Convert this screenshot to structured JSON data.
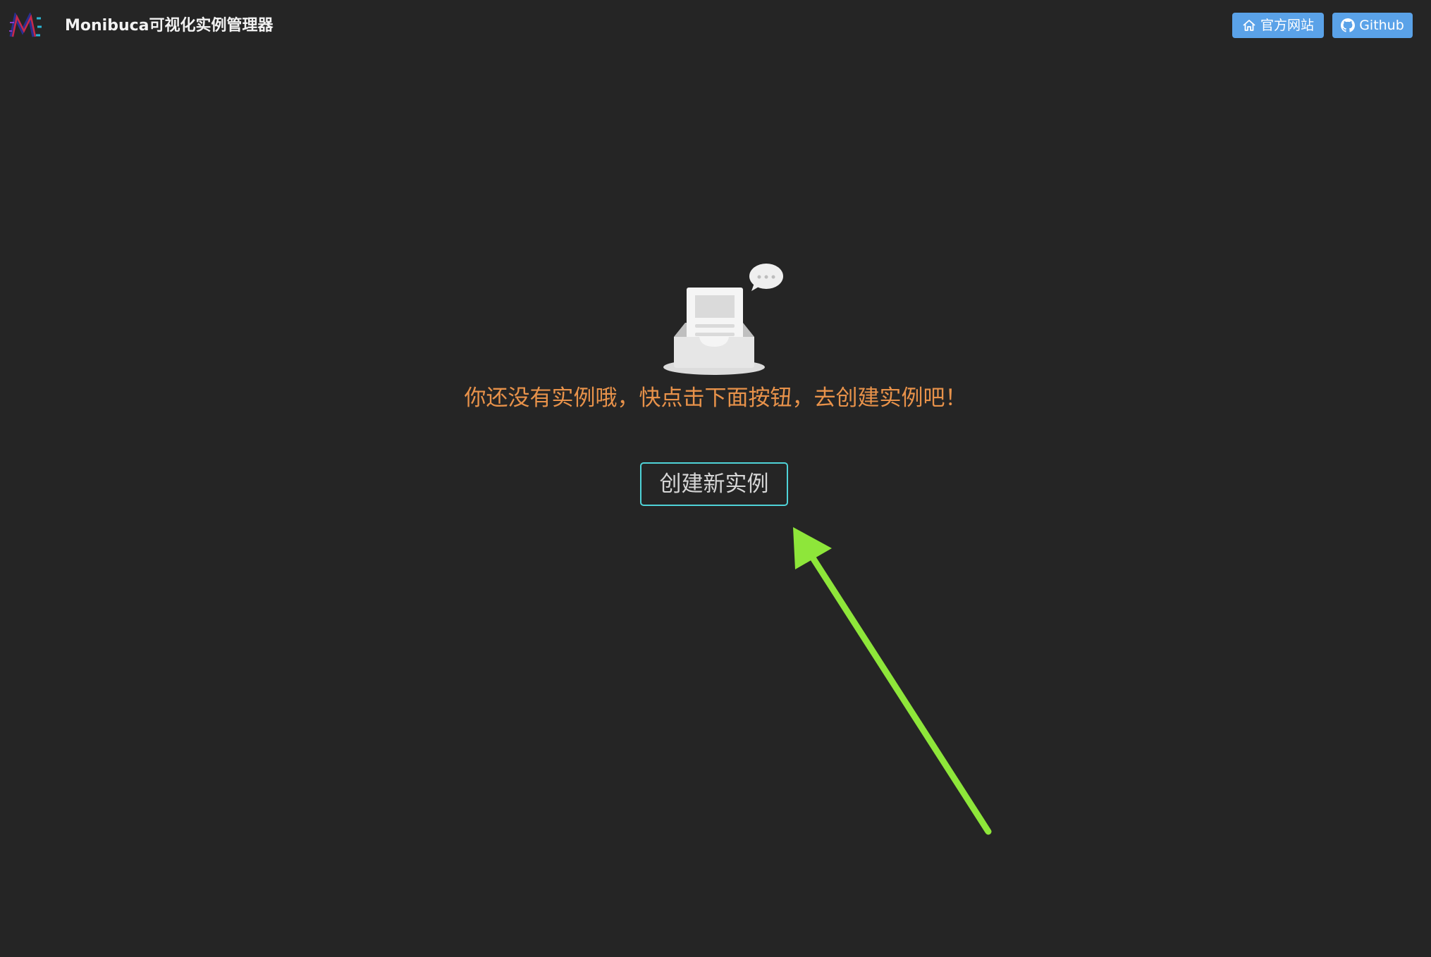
{
  "header": {
    "app_title": "Monibuca可视化实例管理器",
    "logo_icon": "monibuca-logo-icon",
    "buttons": {
      "official_site": {
        "label": "官方网站",
        "icon": "home-icon"
      },
      "github": {
        "label": "Github",
        "icon": "github-icon"
      }
    }
  },
  "empty_state": {
    "illustration": "empty-inbox-icon",
    "message": "你还没有实例哦，快点击下面按钮，去创建实例吧！",
    "create_button_label": "创建新实例"
  },
  "annotation": {
    "arrow_color": "#8ee63a"
  },
  "colors": {
    "background": "#252525",
    "header_button": "#5aa2e8",
    "message_text": "#e8924a",
    "create_button_border": "#4fd3d8"
  }
}
